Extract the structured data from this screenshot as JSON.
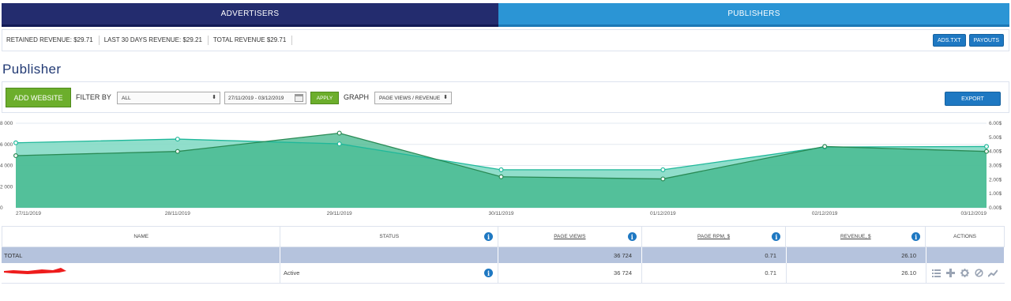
{
  "tabs": {
    "advertisers": "ADVERTISERS",
    "publishers": "PUBLISHERS"
  },
  "revenue": {
    "retained_label": "RETAINED REVENUE:",
    "retained_value": "$29.71",
    "last30_label": "LAST 30 DAYS REVENUE:",
    "last30_value": "$29.21",
    "total_label": "TOTAL REVENUE",
    "total_value": "$29.71",
    "ads_txt_button": "ADS.TXT",
    "payouts_button": "PAYOUTS"
  },
  "page_title": "Publisher",
  "toolbar": {
    "add_website_button": "ADD WEBSITE",
    "filter_by_label": "FILTER BY",
    "filter_value": "ALL",
    "date_range": "27/11/2019 - 03/12/2019",
    "apply_button": "APPLY",
    "graph_label": "GRAPH",
    "graph_value": "PAGE VIEWS / REVENUE",
    "export_button": "EXPORT"
  },
  "colors": {
    "tab_advertisers": "#232c6e",
    "tab_publishers": "#2b95d5",
    "green_button": "#6cae2c",
    "blue_button": "#1e78c2",
    "series_page_views": "#1fb89a",
    "series_revenue": "#2a8a55",
    "total_row_bg": "#b5c3dd"
  },
  "chart_data": {
    "type": "area",
    "x": [
      "27/11/2019",
      "28/11/2019",
      "29/11/2019",
      "30/11/2019",
      "01/12/2019",
      "02/12/2019",
      "03/12/2019"
    ],
    "y_left_ticks": [
      "0",
      "2 000",
      "4 000",
      "6 000",
      "8 000"
    ],
    "y_left_lim": [
      0,
      8000
    ],
    "y_right_ticks": [
      "0.00$",
      "1.00$",
      "2.00$",
      "3.00$",
      "4.00$",
      "5.00$",
      "6.00$"
    ],
    "y_right_lim": [
      0,
      6
    ],
    "series": [
      {
        "values": [
          6150,
          6500,
          6050,
          3600,
          3600,
          5750,
          5800
        ],
        "axis": "left"
      },
      {
        "values": [
          3.7,
          4.0,
          5.3,
          2.2,
          2.05,
          4.35,
          4.0
        ],
        "axis": "right"
      }
    ],
    "grid": true
  },
  "table": {
    "headers": {
      "name": "NAME",
      "status": "STATUS",
      "page_views": "PAGE VIEWS",
      "page_rpm": "PAGE RPM, $",
      "revenue": "REVENUE, $",
      "actions": "ACTIONS"
    },
    "total": {
      "label": "TOTAL",
      "page_views": "36 724",
      "page_rpm": "0.71",
      "revenue": "26.10"
    },
    "rows": [
      {
        "status": "Active",
        "page_views": "36 724",
        "page_rpm": "0.71",
        "revenue": "26.10",
        "actions": [
          "list-icon",
          "plus-icon",
          "gear-icon",
          "block-icon",
          "chart-icon"
        ]
      }
    ]
  }
}
